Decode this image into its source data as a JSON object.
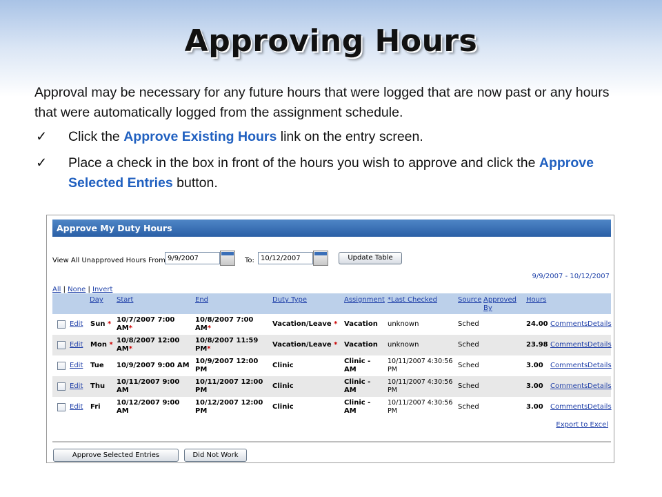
{
  "slide": {
    "title": "Approving Hours",
    "intro": "Approval may be necessary for any future hours that were logged  that are now past or any hours that were automatically logged from the assignment schedule.",
    "bullets": [
      {
        "check": "✓",
        "before": "Click the ",
        "highlight": "Approve Existing Hours",
        "after": " link on the entry screen."
      },
      {
        "check": "✓",
        "before": "Place a check in the box in front of the hours you wish to approve and click the ",
        "highlight": "Approve Selected Entries",
        "after": " button."
      }
    ]
  },
  "app": {
    "header": "Approve My Duty Hours",
    "filter": {
      "from_label": "View All Unapproved Hours From:",
      "from_value": "9/9/2007",
      "to_label": "To:",
      "to_value": "10/12/2007",
      "update_button": "Update Table"
    },
    "range_text": "9/9/2007 - 10/12/2007",
    "select": {
      "all": "All",
      "sep": "|",
      "none": "None",
      "invert": "Invert"
    },
    "columns": {
      "day": "Day",
      "start": "Start",
      "end": "End",
      "duty_type": "Duty Type",
      "assignment": "Assignment",
      "last_checked": "*Last Checked",
      "source": "Source",
      "approved_by_1": "Approved",
      "approved_by_2": "By",
      "hours": "Hours"
    },
    "rows": [
      {
        "edit": "Edit",
        "day": "Sun",
        "day_req": "*",
        "start_1": "10/7/2007 7:00",
        "start_2": "AM",
        "start_req": "*",
        "end_1": "10/8/2007 7:00",
        "end_2": "AM",
        "end_req": "*",
        "duty": "Vacation/Leave",
        "duty_req": "*",
        "assign_1": "Vacation",
        "assign_2": "",
        "checked_1": "unknown",
        "checked_2": "",
        "source": "Sched",
        "hours": "24.00",
        "comments": "Comments",
        "details": "Details"
      },
      {
        "edit": "Edit",
        "day": "Mon",
        "day_req": "*",
        "start_1": "10/8/2007 12:00",
        "start_2": "AM",
        "start_req": "*",
        "end_1": "10/8/2007 11:59",
        "end_2": "PM",
        "end_req": "*",
        "duty": "Vacation/Leave",
        "duty_req": "*",
        "assign_1": "Vacation",
        "assign_2": "",
        "checked_1": "unknown",
        "checked_2": "",
        "source": "Sched",
        "hours": "23.98",
        "comments": "Comments",
        "details": "Details"
      },
      {
        "edit": "Edit",
        "day": "Tue",
        "day_req": "",
        "start_1": "10/9/2007 9:00 AM",
        "start_2": "",
        "start_req": "",
        "end_1": "10/9/2007 12:00",
        "end_2": "PM",
        "end_req": "",
        "duty": "Clinic",
        "duty_req": "",
        "assign_1": "Clinic -",
        "assign_2": "AM",
        "checked_1": "10/11/2007 4:30:56",
        "checked_2": "PM",
        "source": "Sched",
        "hours": "3.00",
        "comments": "Comments",
        "details": "Details"
      },
      {
        "edit": "Edit",
        "day": "Thu",
        "day_req": "",
        "start_1": "10/11/2007 9:00",
        "start_2": "AM",
        "start_req": "",
        "end_1": "10/11/2007 12:00",
        "end_2": "PM",
        "end_req": "",
        "duty": "Clinic",
        "duty_req": "",
        "assign_1": "Clinic -",
        "assign_2": "AM",
        "checked_1": "10/11/2007 4:30:56",
        "checked_2": "PM",
        "source": "Sched",
        "hours": "3.00",
        "comments": "Comments",
        "details": "Details"
      },
      {
        "edit": "Edit",
        "day": "Fri",
        "day_req": "",
        "start_1": "10/12/2007 9:00",
        "start_2": "AM",
        "start_req": "",
        "end_1": "10/12/2007 12:00",
        "end_2": "PM",
        "end_req": "",
        "duty": "Clinic",
        "duty_req": "",
        "assign_1": "Clinic -",
        "assign_2": "AM",
        "checked_1": "10/11/2007 4:30:56",
        "checked_2": "PM",
        "source": "Sched",
        "hours": "3.00",
        "comments": "Comments",
        "details": "Details"
      }
    ],
    "export_link": "Export to Excel",
    "approve_button": "Approve Selected Entries",
    "did_not_work_button": "Did Not Work"
  }
}
